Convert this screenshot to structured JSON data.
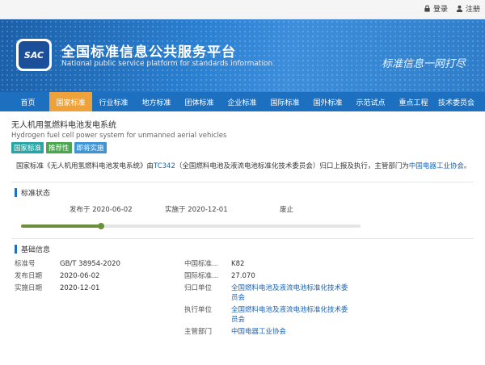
{
  "topbar": {
    "login": "登录",
    "register": "注册"
  },
  "banner": {
    "logo_text": "SAC",
    "title": "全国标准信息公共服务平台",
    "subtitle": "National public service platform  for standards information",
    "slogan": "标准信息一网打尽"
  },
  "nav": [
    {
      "label": "首页"
    },
    {
      "label": "国家标准"
    },
    {
      "label": "行业标准"
    },
    {
      "label": "地方标准"
    },
    {
      "label": "团体标准"
    },
    {
      "label": "企业标准"
    },
    {
      "label": "国际标准"
    },
    {
      "label": "国外标准"
    },
    {
      "label": "示范试点"
    },
    {
      "label": "重点工程"
    },
    {
      "label": "技术委员会"
    }
  ],
  "nav_active": "国家标准",
  "standard": {
    "title_cn": "无人机用氢燃料电池发电系统",
    "title_en": "Hydrogen fuel cell power system for unmanned aerial vehicles",
    "tags": [
      "国家标准",
      "推荐性",
      "即将实施"
    ],
    "desc_prefix": "国家标准《无人机用氢燃料电池发电系统》由",
    "desc_tc": "TC342",
    "desc_mid": "（全国燃料电池及液流电池标准化技术委员会）归口上报及执行，主管部门为",
    "desc_dept": "中国电器工业协会",
    "desc_end": "。"
  },
  "status": {
    "heading": "标准状态",
    "published": "发布于 2020-06-02",
    "implemented": "实施于 2020-12-01",
    "abolished": "废止",
    "progress": 0.23
  },
  "basic": {
    "heading": "基础信息",
    "rows": [
      {
        "k": "标准号",
        "v": "GB/T 38954-2020",
        "k2": "中国标准...",
        "v2": "K82",
        "v2_link": false
      },
      {
        "k": "发布日期",
        "v": "2020-06-02",
        "k2": "国际标准...",
        "v2": "27.070",
        "v2_link": false
      },
      {
        "k": "实施日期",
        "v": "2020-12-01",
        "k2": "归口单位",
        "v2": "全国燃料电池及液流电池标准化技术委员会",
        "v2_link": true
      },
      {
        "k": "",
        "v": "",
        "k2": "执行单位",
        "v2": "全国燃料电池及液流电池标准化技术委员会",
        "v2_link": true
      },
      {
        "k": "",
        "v": "",
        "k2": "主管部门",
        "v2": "中国电器工业协会",
        "v2_link": true
      }
    ]
  },
  "colors": {
    "nav_bg": "#1d6fbf",
    "nav_active": "#f0a23a",
    "link": "#1a62b5",
    "progress": "#6b8f3b"
  }
}
